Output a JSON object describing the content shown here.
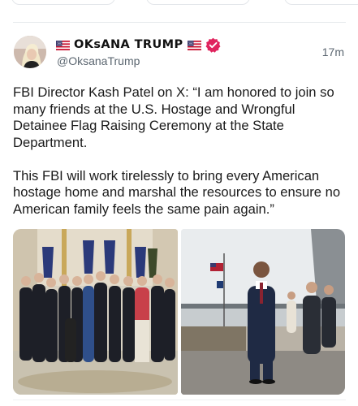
{
  "post": {
    "display_name": "OKsANA TRUMP",
    "handle": "@OksanaTrump",
    "timestamp": "17m",
    "paragraphs": [
      "FBI Director Kash Patel on X: “I am honored to join so many friends at the U.S. Hostage and Wrongful Detainee Flag Raising Ceremony at the State Department.",
      "This FBI will work tirelessly to bring every American hostage home and marshal the resources to ensure no American family feels the same pain again.”"
    ],
    "flag_icon": "us-flag-icon",
    "verified_icon": "verified-badge-icon",
    "verified_color": "#e0245e"
  },
  "media": [
    {
      "name": "group-photo",
      "icon": "photo"
    },
    {
      "name": "balcony-photo",
      "icon": "photo"
    }
  ]
}
